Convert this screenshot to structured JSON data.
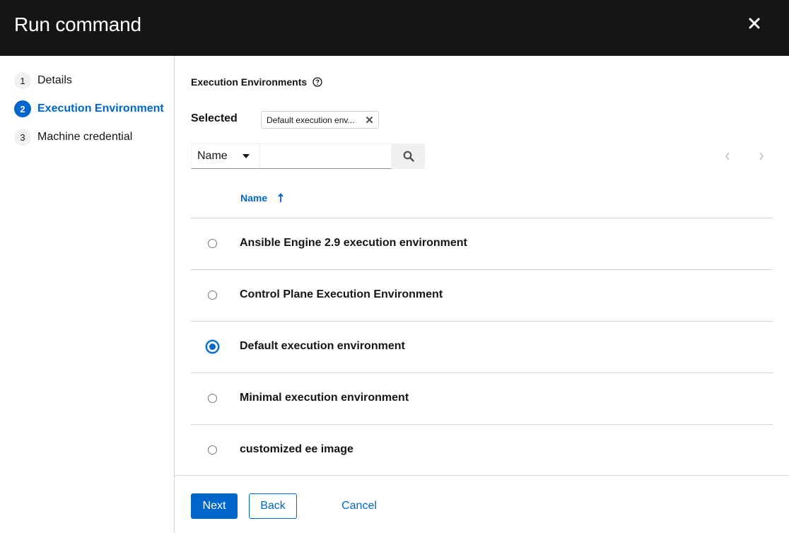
{
  "modal": {
    "title": "Run command",
    "close_icon": "close-icon"
  },
  "wizard_nav": {
    "steps": [
      {
        "number": "1",
        "label": "Details",
        "current": false
      },
      {
        "number": "2",
        "label": "Execution Environment",
        "current": true
      },
      {
        "number": "3",
        "label": "Machine credential",
        "current": false
      }
    ]
  },
  "execution_env": {
    "section_label": "Execution Environments",
    "help_icon": "help-circle-icon",
    "selected_label": "Selected",
    "selected_chip": "Default execution env..."
  },
  "toolbar": {
    "filter_selected": "Name",
    "search_value": "",
    "search_placeholder": "",
    "search_icon": "search-icon",
    "prev_icon": "chevron-left-icon",
    "next_icon": "chevron-right-icon"
  },
  "table": {
    "column_header": "Name",
    "sort_icon": "sort-ascending-icon",
    "rows": [
      {
        "name": "Ansible Engine 2.9 execution environment",
        "selected": false
      },
      {
        "name": "Control Plane Execution Environment",
        "selected": false
      },
      {
        "name": "Default execution environment",
        "selected": true
      },
      {
        "name": "Minimal execution environment",
        "selected": false
      },
      {
        "name": "customized ee image",
        "selected": false
      }
    ]
  },
  "footer": {
    "next_label": "Next",
    "back_label": "Back",
    "cancel_label": "Cancel"
  },
  "colors": {
    "header_bg": "#151515",
    "accent": "#0066cc",
    "border": "#d2d2d2"
  }
}
